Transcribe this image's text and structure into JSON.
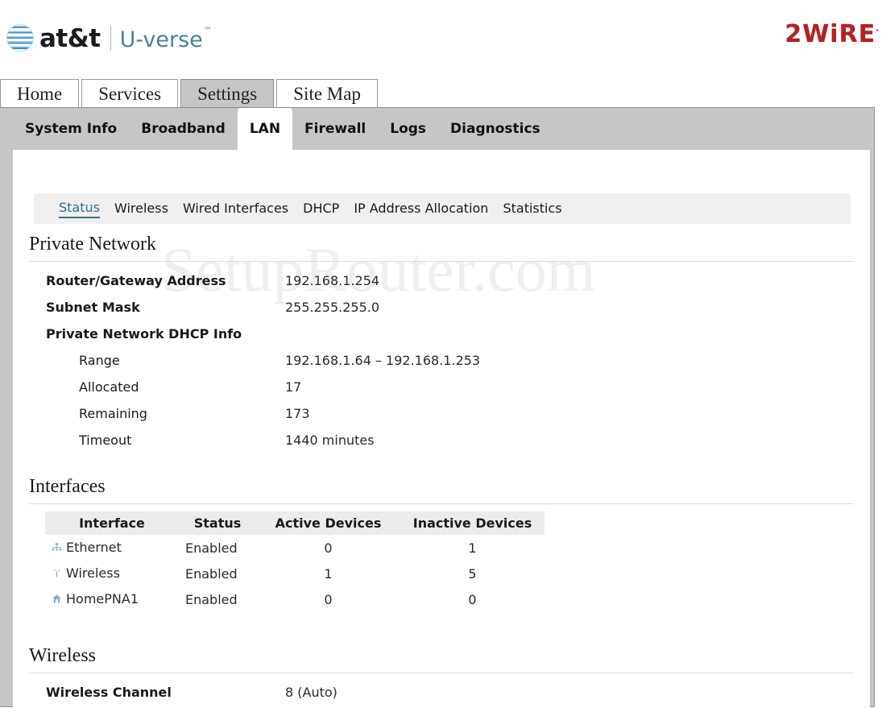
{
  "branding": {
    "att_wordmark": "at&t",
    "uverse_wordmark": "U-verse",
    "uverse_tm": "™",
    "vendor_logo": "2WiRE",
    "vendor_tm": "·",
    "globe_icon": "att-globe-icon"
  },
  "watermark": "SetupRouter.com",
  "primary_tabs": [
    {
      "label": "Home",
      "active": false
    },
    {
      "label": "Services",
      "active": false
    },
    {
      "label": "Settings",
      "active": true
    },
    {
      "label": "Site Map",
      "active": false
    }
  ],
  "secondary_tabs": [
    {
      "label": "System Info",
      "active": false
    },
    {
      "label": "Broadband",
      "active": false
    },
    {
      "label": "LAN",
      "active": true
    },
    {
      "label": "Firewall",
      "active": false
    },
    {
      "label": "Logs",
      "active": false
    },
    {
      "label": "Diagnostics",
      "active": false
    }
  ],
  "subnav": [
    {
      "label": "Status",
      "active": true
    },
    {
      "label": "Wireless",
      "active": false
    },
    {
      "label": "Wired Interfaces",
      "active": false
    },
    {
      "label": "DHCP",
      "active": false
    },
    {
      "label": "IP Address Allocation",
      "active": false
    },
    {
      "label": "Statistics",
      "active": false
    }
  ],
  "private_network": {
    "title": "Private Network",
    "rows": [
      {
        "label": "Router/Gateway Address",
        "value": "192.168.1.254",
        "indent": false
      },
      {
        "label": "Subnet Mask",
        "value": "255.255.255.0",
        "indent": false
      },
      {
        "label": "Private Network DHCP Info",
        "value": "",
        "indent": false
      },
      {
        "label": "Range",
        "value": "192.168.1.64 – 192.168.1.253",
        "indent": true
      },
      {
        "label": "Allocated",
        "value": "17",
        "indent": true
      },
      {
        "label": "Remaining",
        "value": "173",
        "indent": true
      },
      {
        "label": "Timeout",
        "value": "1440 minutes",
        "indent": true
      }
    ]
  },
  "interfaces": {
    "title": "Interfaces",
    "columns": [
      "Interface",
      "Status",
      "Active Devices",
      "Inactive Devices"
    ],
    "rows": [
      {
        "icon": "ethernet-icon",
        "interface": "Ethernet",
        "status": "Enabled",
        "active_devices": "0",
        "inactive_devices": "1"
      },
      {
        "icon": "wireless-icon",
        "interface": "Wireless",
        "status": "Enabled",
        "active_devices": "1",
        "inactive_devices": "5"
      },
      {
        "icon": "homepna-icon",
        "interface": "HomePNA1",
        "status": "Enabled",
        "active_devices": "0",
        "inactive_devices": "0"
      }
    ]
  },
  "wireless": {
    "title": "Wireless",
    "rows": [
      {
        "label": "Wireless Channel",
        "value": "8 (Auto)"
      }
    ]
  },
  "colors": {
    "accent_blue": "#3a6f8f",
    "vendor_red": "#b22222",
    "panel_gray": "#c6c6c6",
    "subnav_gray": "#f0f0f0",
    "table_header_gray": "#ececec"
  }
}
